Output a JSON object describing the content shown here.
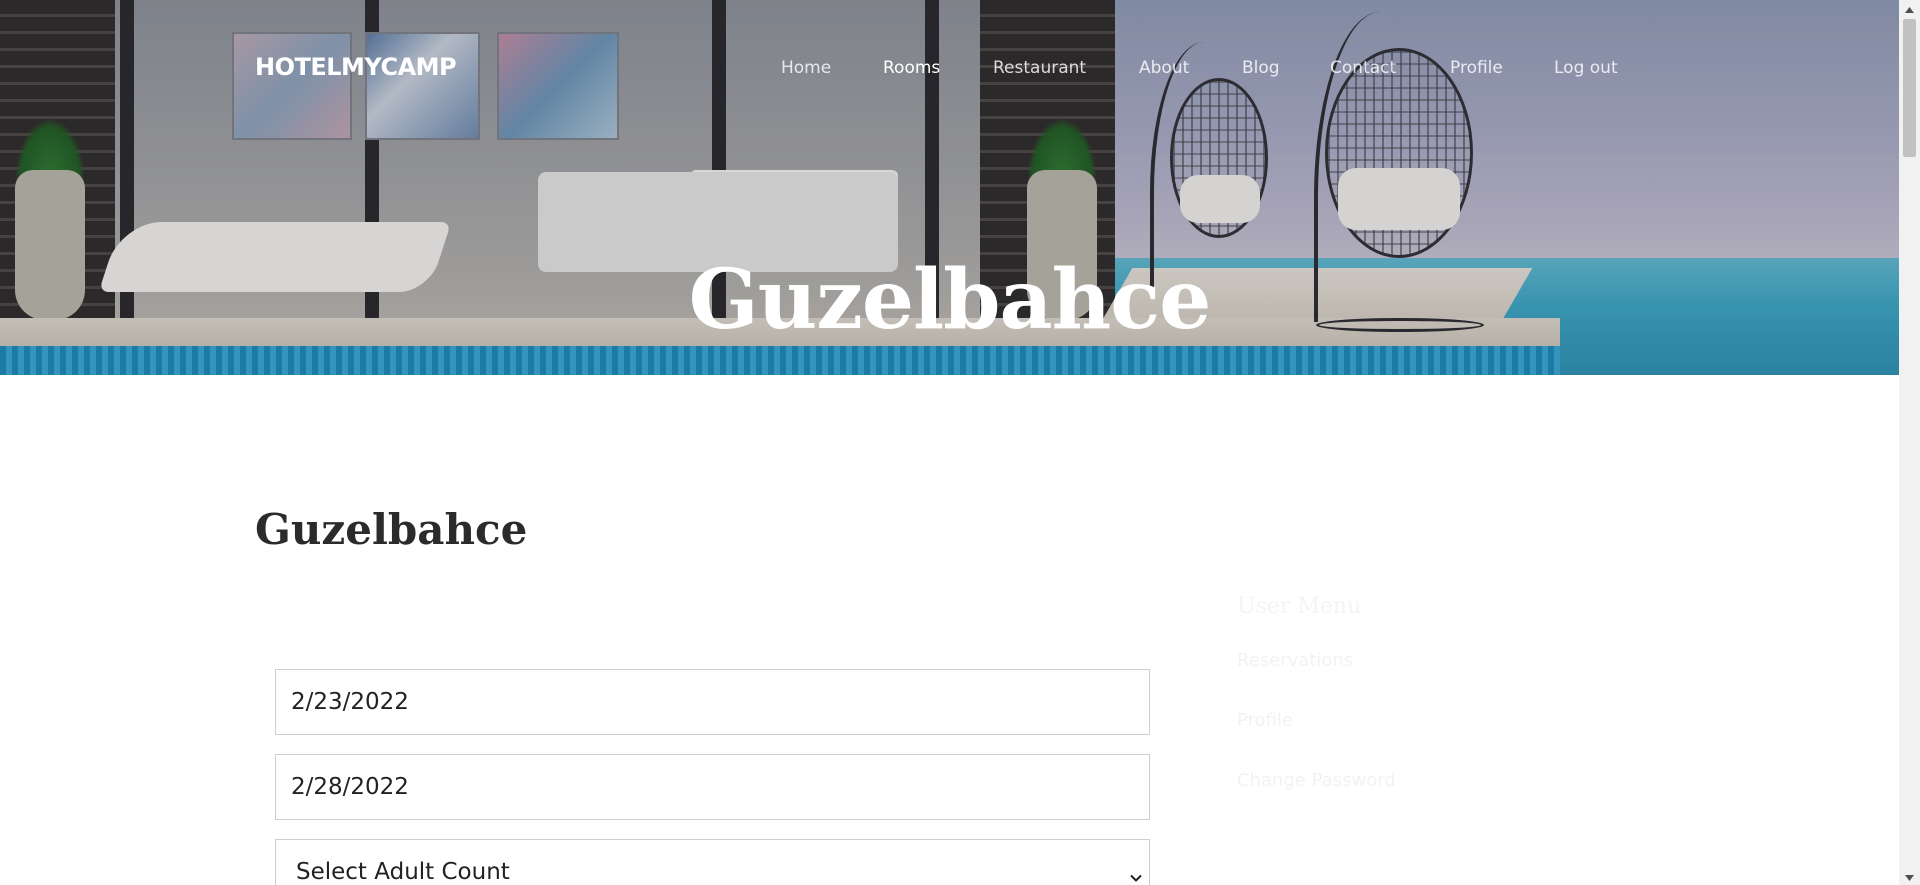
{
  "brand": "HOTELMYCAMP",
  "nav": {
    "items": [
      {
        "label": "Home"
      },
      {
        "label": "Rooms"
      },
      {
        "label": "Restaurant"
      },
      {
        "label": "About"
      },
      {
        "label": "Blog"
      },
      {
        "label": "Contact"
      },
      {
        "label": "Profile"
      },
      {
        "label": "Log out"
      }
    ],
    "active": "Rooms"
  },
  "hero": {
    "title": "Guzelbahce"
  },
  "page": {
    "heading": "Guzelbahce"
  },
  "form": {
    "checkin_value": "2/23/2022",
    "checkout_value": "2/28/2022",
    "adult_select": "Select Adult Count"
  },
  "user_menu": {
    "title": "User Menu",
    "items": [
      {
        "label": "Reservations"
      },
      {
        "label": "Profile"
      },
      {
        "label": "Change Password"
      }
    ]
  },
  "icons": {
    "select_chevron": "chevron-down-icon",
    "scroll_up": "triangle-up-icon",
    "scroll_down": "triangle-down-icon"
  }
}
